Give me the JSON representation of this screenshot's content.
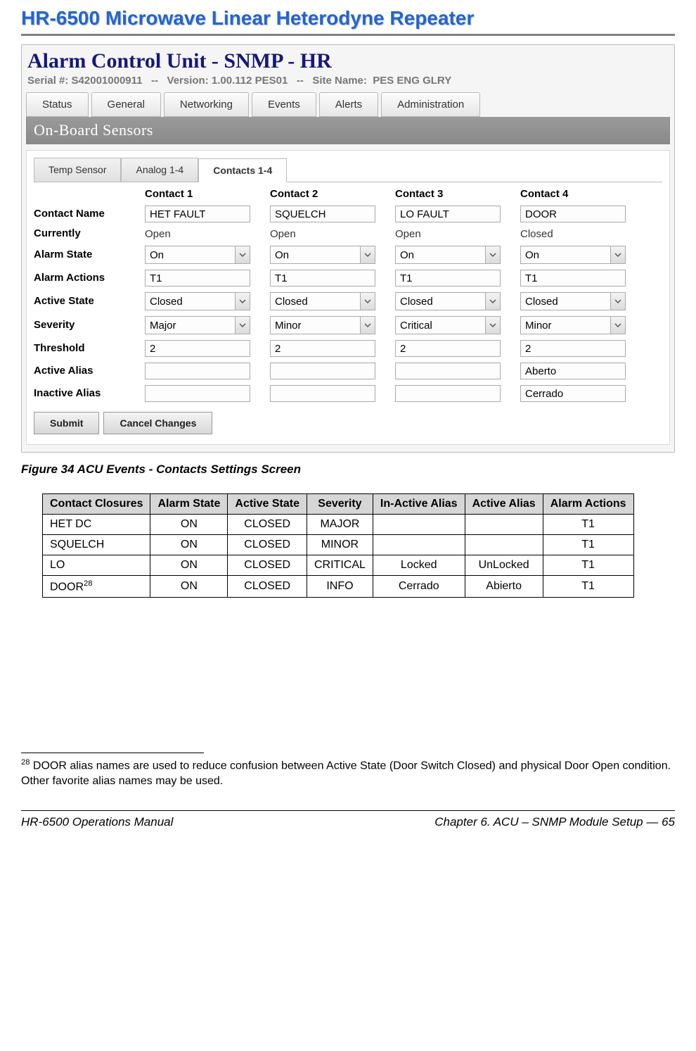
{
  "doc_title": "HR-6500 Microwave Linear Heterodyne Repeater",
  "acu": {
    "heading": "Alarm Control Unit - SNMP - HR",
    "serial_label": "Serial #:",
    "serial": "S42001000911",
    "sep": "--",
    "version_label": "Version:",
    "version": "1.00.112 PES01",
    "site_label": "Site Name:",
    "site": "PES ENG GLRY",
    "tabs": [
      "Status",
      "General",
      "Networking",
      "Events",
      "Alerts",
      "Administration"
    ],
    "section_title": "On-Board Sensors",
    "subtabs": [
      "Temp Sensor",
      "Analog 1-4",
      "Contacts 1-4"
    ],
    "active_subtab_index": 2,
    "col_headers": [
      "Contact 1",
      "Contact 2",
      "Contact 3",
      "Contact 4"
    ],
    "row_labels": {
      "contact_name": "Contact Name",
      "currently": "Currently",
      "alarm_state": "Alarm State",
      "alarm_actions": "Alarm Actions",
      "active_state": "Active State",
      "severity": "Severity",
      "threshold": "Threshold",
      "active_alias": "Active Alias",
      "inactive_alias": "Inactive Alias"
    },
    "contacts": [
      {
        "name": "HET FAULT",
        "currently": "Open",
        "alarm_state": "On",
        "alarm_actions": "T1",
        "active_state": "Closed",
        "severity": "Major",
        "threshold": "2",
        "active_alias": "",
        "inactive_alias": ""
      },
      {
        "name": "SQUELCH",
        "currently": "Open",
        "alarm_state": "On",
        "alarm_actions": "T1",
        "active_state": "Closed",
        "severity": "Minor",
        "threshold": "2",
        "active_alias": "",
        "inactive_alias": ""
      },
      {
        "name": "LO FAULT",
        "currently": "Open",
        "alarm_state": "On",
        "alarm_actions": "T1",
        "active_state": "Closed",
        "severity": "Critical",
        "threshold": "2",
        "active_alias": "",
        "inactive_alias": ""
      },
      {
        "name": "DOOR",
        "currently": "Closed",
        "alarm_state": "On",
        "alarm_actions": "T1",
        "active_state": "Closed",
        "severity": "Minor",
        "threshold": "2",
        "active_alias": "Aberto",
        "inactive_alias": "Cerrado"
      }
    ],
    "buttons": {
      "submit": "Submit",
      "cancel": "Cancel Changes"
    }
  },
  "figure_caption": "Figure 34  ACU Events - Contacts Settings Screen",
  "summary": {
    "headers": [
      "Contact Closures",
      "Alarm State",
      "Active State",
      "Severity",
      "In-Active Alias",
      "Active Alias",
      "Alarm Actions"
    ],
    "rows": [
      {
        "cc": "HET DC",
        "alarm_state": "ON",
        "active_state": "CLOSED",
        "severity": "MAJOR",
        "inactive_alias": "",
        "active_alias": "",
        "actions": "T1"
      },
      {
        "cc": "SQUELCH",
        "alarm_state": "ON",
        "active_state": "CLOSED",
        "severity": "MINOR",
        "inactive_alias": "",
        "active_alias": "",
        "actions": "T1"
      },
      {
        "cc": "LO",
        "alarm_state": "ON",
        "active_state": "CLOSED",
        "severity": "CRITICAL",
        "inactive_alias": "Locked",
        "active_alias": "UnLocked",
        "actions": "T1"
      },
      {
        "cc": "DOOR",
        "footnote_ref": "28",
        "alarm_state": "ON",
        "active_state": "CLOSED",
        "severity": "INFO",
        "inactive_alias": "Cerrado",
        "active_alias": "Abierto",
        "actions": "T1"
      }
    ]
  },
  "footnote": {
    "ref": "28",
    "text": " DOOR alias names are used to reduce confusion between Active State (Door Switch Closed) and physical Door Open condition. Other favorite alias names may be used."
  },
  "footer": {
    "left": "HR-6500 Operations Manual",
    "right": "Chapter 6. ACU – SNMP Module Setup — 65"
  }
}
